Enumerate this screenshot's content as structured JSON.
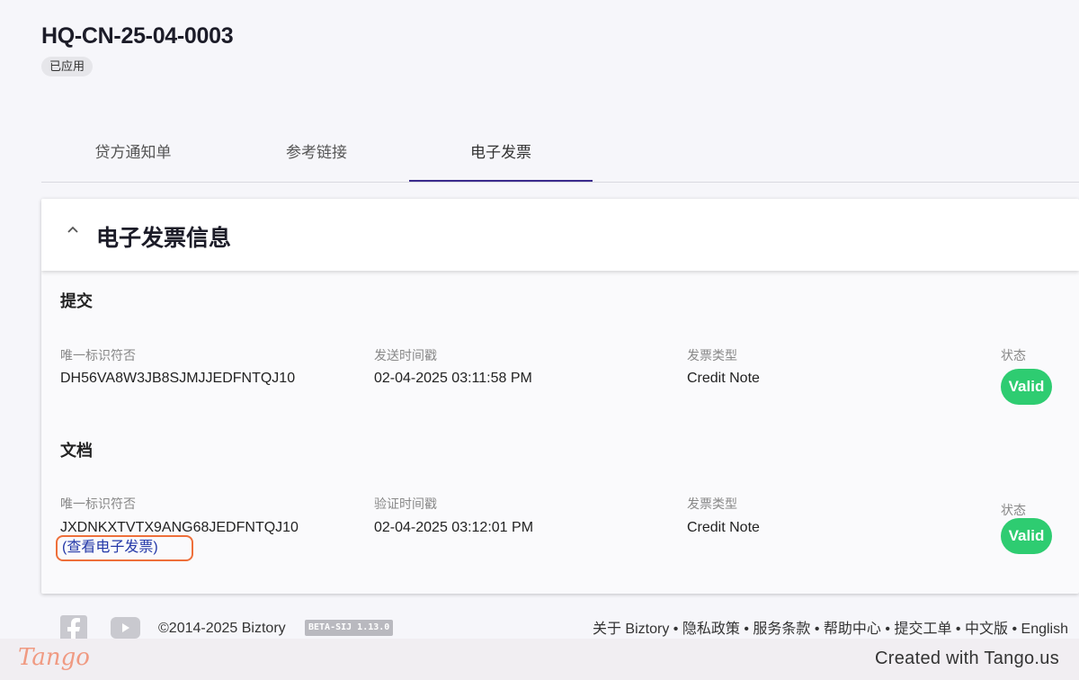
{
  "header": {
    "title": "HQ-CN-25-04-0003",
    "status": "已应用"
  },
  "tabs": [
    {
      "label": "贷方通知单"
    },
    {
      "label": "参考链接"
    },
    {
      "label": "电子发票"
    }
  ],
  "card": {
    "title": "电子发票信息",
    "submission": {
      "section_title": "提交",
      "uid_label": "唯一标识符否",
      "uid_value": "DH56VA8W3JB8SJMJJEDFNTQJ10",
      "time_label": "发送时间戳",
      "time_value": "02-04-2025 03:11:58 PM",
      "type_label": "发票类型",
      "type_value": "Credit Note",
      "status_label": "状态",
      "status_value": "Valid"
    },
    "document": {
      "section_title": "文档",
      "uid_label": "唯一标识符否",
      "uid_value": "JXDNKXTVTX9ANG68JEDFNTQJ10",
      "view_link": "(查看电子发票)",
      "time_label": "验证时间戳",
      "time_value": "02-04-2025 03:12:01 PM",
      "type_label": "发票类型",
      "type_value": "Credit Note",
      "status_label": "状态",
      "status_value": "Valid"
    }
  },
  "footer": {
    "copyright": "©2014-2025 Biztory",
    "version": "BETA-SIJ 1.13.0",
    "links": [
      "关于 Biztory",
      "隐私政策",
      "服务条款",
      "帮助中心",
      "提交工单",
      "中文版",
      "English"
    ],
    "separator": "•"
  },
  "tango": {
    "logo": "Tango",
    "credit": "Created with Tango.us"
  },
  "colors": {
    "valid_badge": "#2ecc71",
    "active_tab_underline": "#3b2c8c",
    "highlight_outline": "#ee6f3a",
    "link": "#2438a8"
  }
}
